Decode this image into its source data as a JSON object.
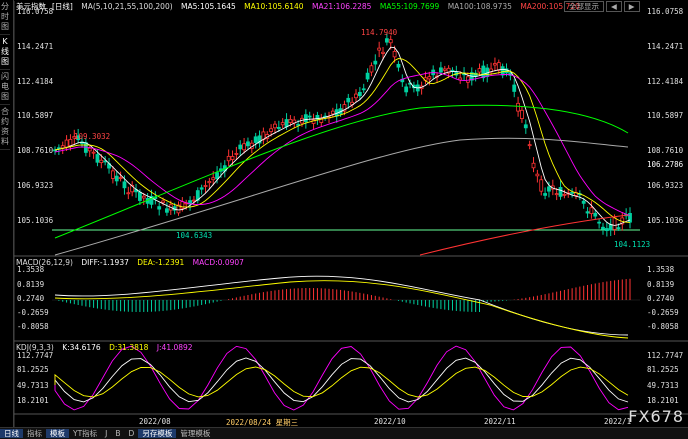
{
  "sidebar": {
    "items": [
      "分时图",
      "K线图",
      "闪电图",
      "合约资料"
    ]
  },
  "main_legend": {
    "title": "美元指数",
    "period": "[日线]",
    "ma_name": "MA(5,10,21,55,100,200)",
    "ma5": "MA5:105.1645",
    "ma10": "MA10:105.6140",
    "ma21": "MA21:106.2285",
    "ma55": "MA55:109.7699",
    "ma100": "MA100:108.9735",
    "ma200": "MA200:105.720"
  },
  "top_buttons": {
    "all_label": "全部显示",
    "left": "◀",
    "right": "▶"
  },
  "price_axis": [
    "116.0758",
    "114.2471",
    "112.4184",
    "110.5897",
    "108.7610",
    "106.9323",
    "105.1036"
  ],
  "current_price": "106.2786",
  "annotations": {
    "high": "114.7940",
    "left_peak": "109.3032",
    "left_low": "104.6343",
    "right_low": "104.1123"
  },
  "macd_legend": {
    "name": "MACD(26,12,9)",
    "diff": "DIFF:-1.1937",
    "dea": "DEA:-1.2391",
    "macd": "MACD:0.0907"
  },
  "macd_axis": [
    "1.3538",
    "0.8139",
    "0.2740",
    "-0.2659",
    "-0.8058"
  ],
  "kdj_legend": {
    "name": "KDJ(9,3,3)",
    "k": "K:34.6176",
    "d": "D:31.3818",
    "j": "J:41.0892"
  },
  "kdj_axis": [
    "112.7747",
    "81.2525",
    "49.7313",
    "18.2101"
  ],
  "date_axis": [
    "2022/08",
    "2022/08/24 星期三",
    "2022/10",
    "2022/11",
    "2022/1"
  ],
  "bottom_tabs": [
    "日线",
    "指标",
    "模板",
    "YT指标",
    "J",
    "B",
    "D",
    "另存模板",
    "管理模板"
  ],
  "watermark": "FX678",
  "colors": {
    "up": "#ff3333",
    "down": "#00d0a0",
    "ma5": "#ffffff",
    "ma10": "#ffff00",
    "ma21": "#ff00ff",
    "ma55": "#00ff00",
    "ma100": "#aaaaaa",
    "ma200": "#ff3333"
  }
}
